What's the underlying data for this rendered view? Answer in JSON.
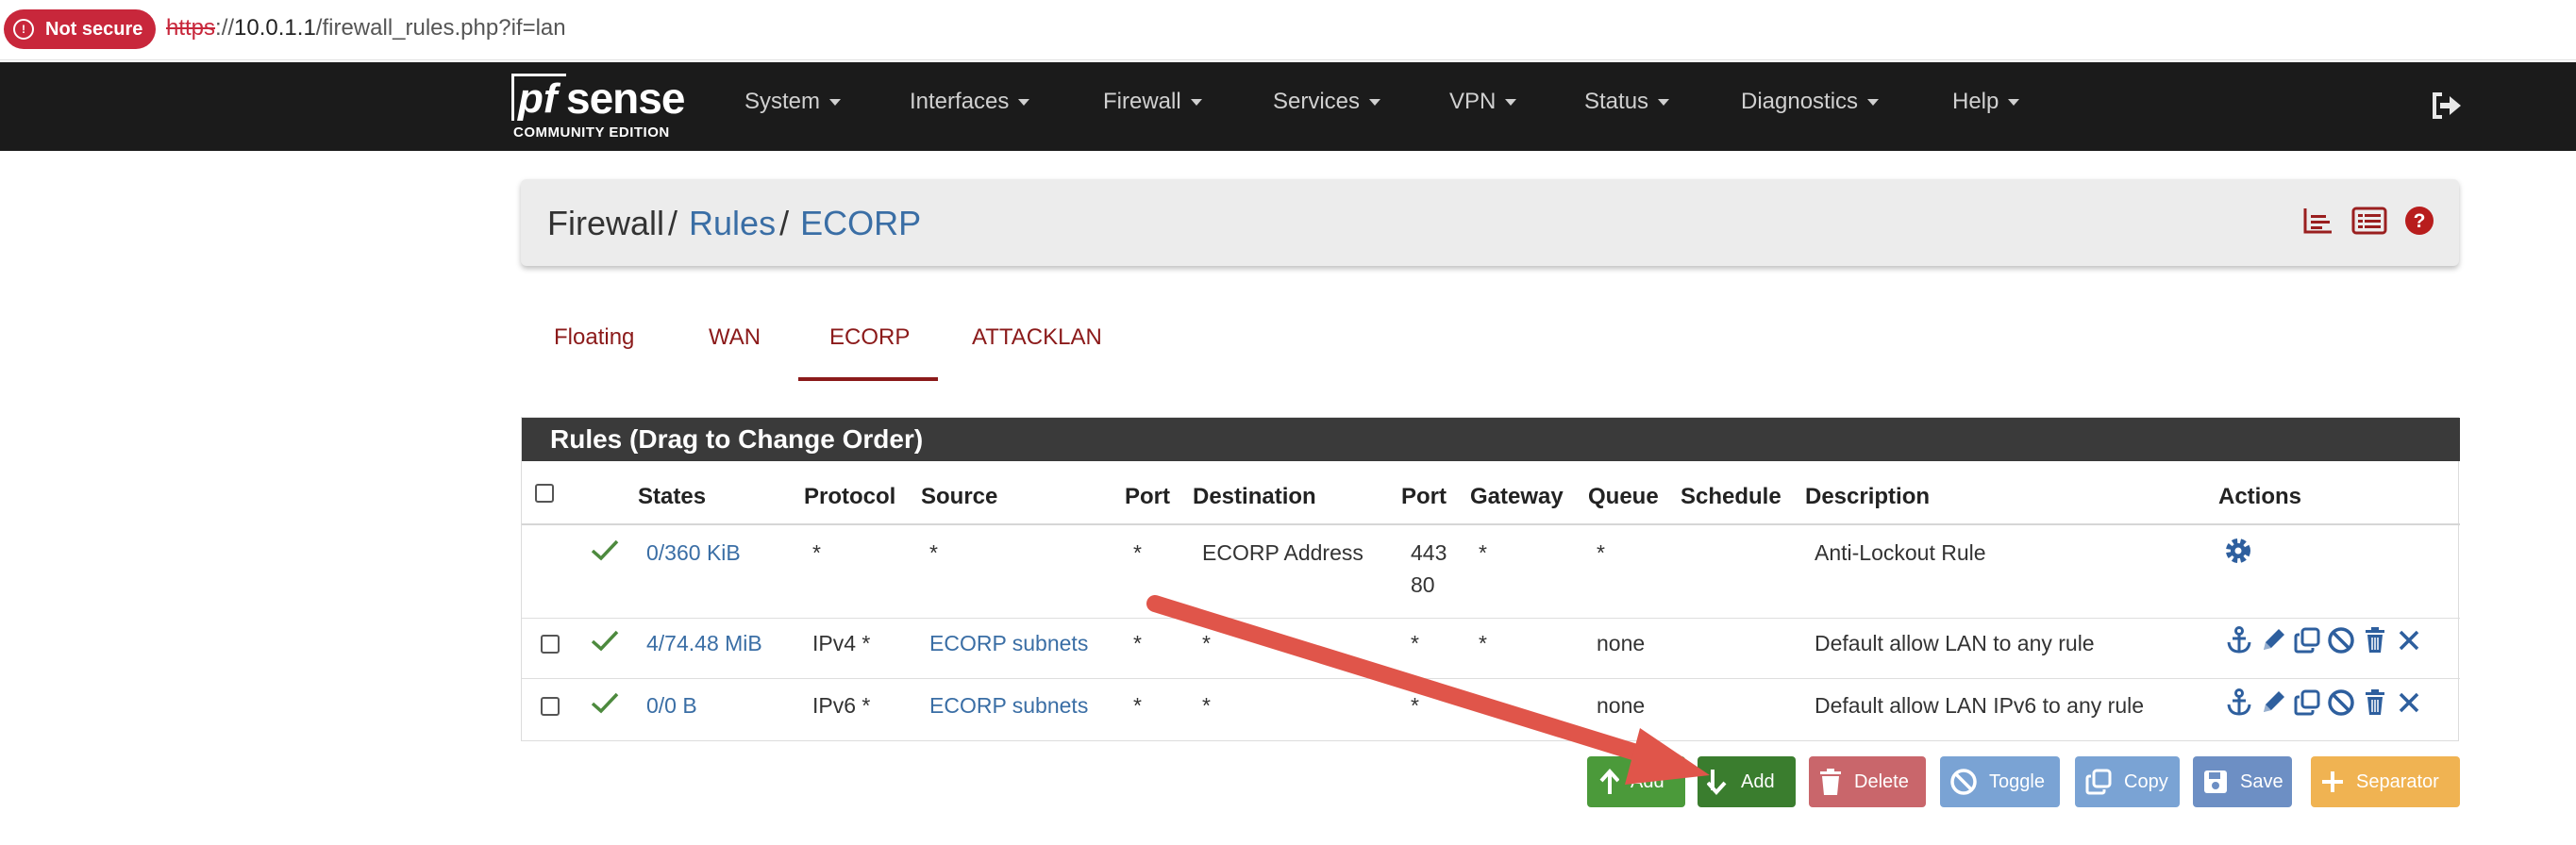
{
  "browser": {
    "security_label": "Not secure",
    "url_scheme": "https",
    "url_rest": "://",
    "url_host": "10.0.1.1",
    "url_path": "/firewall_rules.php?if=lan"
  },
  "brand": {
    "logo_pf": "pf",
    "logo_sense": "sense",
    "logo_sub": "COMMUNITY EDITION"
  },
  "nav": {
    "items": [
      "System",
      "Interfaces",
      "Firewall",
      "Services",
      "VPN",
      "Status",
      "Diagnostics",
      "Help"
    ]
  },
  "breadcrumb": {
    "root": "Firewall",
    "sep": "/",
    "rules": "Rules",
    "iface": "ECORP"
  },
  "tabs": [
    "Floating",
    "WAN",
    "ECORP",
    "ATTACKLAN"
  ],
  "active_tab": "ECORP",
  "table": {
    "title": "Rules (Drag to Change Order)",
    "columns": [
      "States",
      "Protocol",
      "Source",
      "Port",
      "Destination",
      "Port",
      "Gateway",
      "Queue",
      "Schedule",
      "Description",
      "Actions"
    ],
    "rows": [
      {
        "states": "0/360 KiB",
        "protocol": "*",
        "source": "*",
        "src_port": "*",
        "destination": "ECORP Address",
        "dst_port_1": "443",
        "dst_port_2": "80",
        "gateway": "*",
        "queue": "*",
        "schedule": "",
        "description": "Anti-Lockout Rule"
      },
      {
        "states": "4/74.48 MiB",
        "protocol": "IPv4 *",
        "source": "ECORP subnets",
        "src_port": "*",
        "destination": "*",
        "dst_port_1": "*",
        "dst_port_2": "",
        "gateway": "*",
        "queue": "none",
        "schedule": "",
        "description": "Default allow LAN to any rule"
      },
      {
        "states": "0/0 B",
        "protocol": "IPv6 *",
        "source": "ECORP subnets",
        "src_port": "*",
        "destination": "*",
        "dst_port_1": "*",
        "dst_port_2": "",
        "gateway": "",
        "queue": "none",
        "schedule": "",
        "description": "Default allow LAN IPv6 to any rule"
      }
    ]
  },
  "buttons": {
    "add_top": "Add",
    "add_bottom": "Add",
    "delete": "Delete",
    "toggle": "Toggle",
    "copy": "Copy",
    "save": "Save",
    "separator": "Separator"
  },
  "colors": {
    "navbar": "#1b1b1b",
    "link": "#3a6ea5",
    "tab": "#8b1a1a",
    "not_secure": "#c8273b",
    "arrow": "#e0554a"
  }
}
